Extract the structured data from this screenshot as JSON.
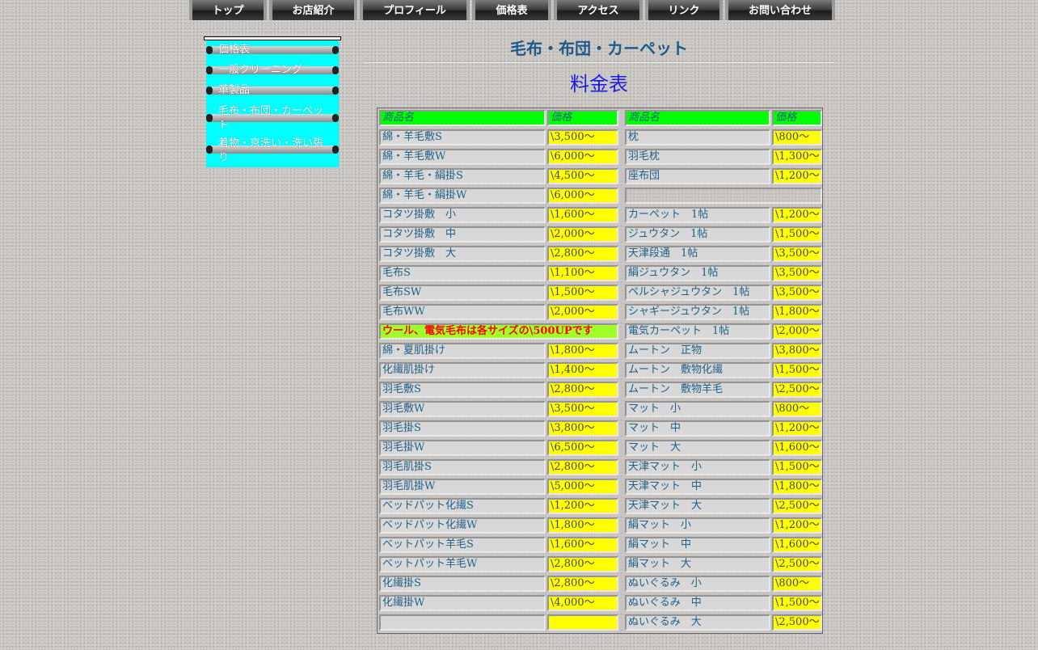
{
  "nav": [
    "トップ",
    "お店紹介",
    "プロフィール",
    "価格表",
    "アクセス",
    "リンク",
    "お問い合わせ"
  ],
  "sidebar": [
    {
      "label": "価格表"
    },
    {
      "label": "一般クリーニング"
    },
    {
      "label": "革製品"
    },
    {
      "label": "毛布・布団・カーペット"
    },
    {
      "label": "着物・京洗い・洗い張り"
    }
  ],
  "page": {
    "title": "毛布・布団・カーペット",
    "subtitle": "料金表"
  },
  "table": {
    "header": {
      "name": "商品名",
      "price": "価格"
    },
    "left": [
      {
        "name": "綿・羊毛敷S",
        "price": "\\3,500～"
      },
      {
        "name": "綿・羊毛敷W",
        "price": "\\6,000～"
      },
      {
        "name": "綿・羊毛・絹掛S",
        "price": "\\4,500～"
      },
      {
        "name": "綿・羊毛・絹掛W",
        "price": "\\6,000～"
      },
      {
        "name": "コタツ掛敷　小",
        "price": "\\1,600～"
      },
      {
        "name": "コタツ掛敷　中",
        "price": "\\2,000～"
      },
      {
        "name": "コタツ掛敷　大",
        "price": "\\2,800～"
      },
      {
        "name": "毛布S",
        "price": "\\1,100～"
      },
      {
        "name": "毛布SW",
        "price": "\\1,500～"
      },
      {
        "name": "毛布WW",
        "price": "\\2,000～"
      },
      {
        "note": "ウール、電気毛布は各サイズの\\500UPです"
      },
      {
        "name": "綿・夏肌掛け",
        "price": "\\1,800～"
      },
      {
        "name": "化繊肌掛け",
        "price": "\\1,400～"
      },
      {
        "name": "羽毛敷S",
        "price": "\\2,800～"
      },
      {
        "name": "羽毛敷W",
        "price": "\\3,500～"
      },
      {
        "name": "羽毛掛S",
        "price": "\\3,800～"
      },
      {
        "name": "羽毛掛W",
        "price": "\\6,500～"
      },
      {
        "name": "羽毛肌掛S",
        "price": "\\2,800～"
      },
      {
        "name": "羽毛肌掛W",
        "price": "\\5,000～"
      },
      {
        "name": "ベッドパット化繊S",
        "price": "\\1,200～"
      },
      {
        "name": "ベッドパット化繊W",
        "price": "\\1,800～"
      },
      {
        "name": "ベットパット羊毛S",
        "price": "\\1,600～"
      },
      {
        "name": "ベットパット羊毛W",
        "price": "\\2,800～"
      },
      {
        "name": "化繊掛S",
        "price": "\\2,800～"
      },
      {
        "name": "化繊掛W",
        "price": "\\4,000～"
      },
      {
        "name": "",
        "price": ""
      }
    ],
    "right": [
      {
        "name": "枕",
        "price": "\\800～"
      },
      {
        "name": "羽毛枕",
        "price": "\\1,300～"
      },
      {
        "name": "座布団",
        "price": "\\1,200～"
      },
      {
        "blank": true
      },
      {
        "name": "カーペット　1帖",
        "price": "\\1,200～"
      },
      {
        "name": "ジュウタン　1帖",
        "price": "\\1,500～"
      },
      {
        "name": "天津段通　1帖",
        "price": "\\3,500～"
      },
      {
        "name": "絹ジュウタン　1帖",
        "price": "\\3,500～"
      },
      {
        "name": "ペルシャジュウタン　1帖",
        "price": "\\3,500～"
      },
      {
        "name": "シャギージュウタン　1帖",
        "price": "\\1,800～"
      },
      {
        "name": "電気カーペット　1帖",
        "price": "\\2,000～"
      },
      {
        "name": "ムートン　正物",
        "price": "\\3,800～"
      },
      {
        "name": "ムートン　敷物化繊",
        "price": "\\1,500～"
      },
      {
        "name": "ムートン　敷物羊毛",
        "price": "\\2,500～"
      },
      {
        "name": "マット　小",
        "price": "\\800～"
      },
      {
        "name": "マット　中",
        "price": "\\1,200～"
      },
      {
        "name": "マット　大",
        "price": "\\1,600～"
      },
      {
        "name": "天津マット　小",
        "price": "\\1,500～"
      },
      {
        "name": "天津マット　中",
        "price": "\\1,800～"
      },
      {
        "name": "天津マット　大",
        "price": "\\2,500～"
      },
      {
        "name": "絹マット　小",
        "price": "\\1,200～"
      },
      {
        "name": "絹マット　中",
        "price": "\\1,600～"
      },
      {
        "name": "絹マット　大",
        "price": "\\2,500～"
      },
      {
        "name": "ぬいぐるみ　小",
        "price": "\\800～"
      },
      {
        "name": "ぬいぐるみ　中",
        "price": "\\1,500～"
      },
      {
        "name": "ぬいぐるみ　大",
        "price": "\\2,500～"
      }
    ]
  },
  "colors": {
    "header_bg": "#00ff00",
    "price_bg": "#ffff00",
    "note_bg": "#a0ff2a",
    "note_text": "#ff0000",
    "sidebar_bg": "#00ffff",
    "title": "#1e5a8a",
    "subtitle": "#1b1be6"
  }
}
